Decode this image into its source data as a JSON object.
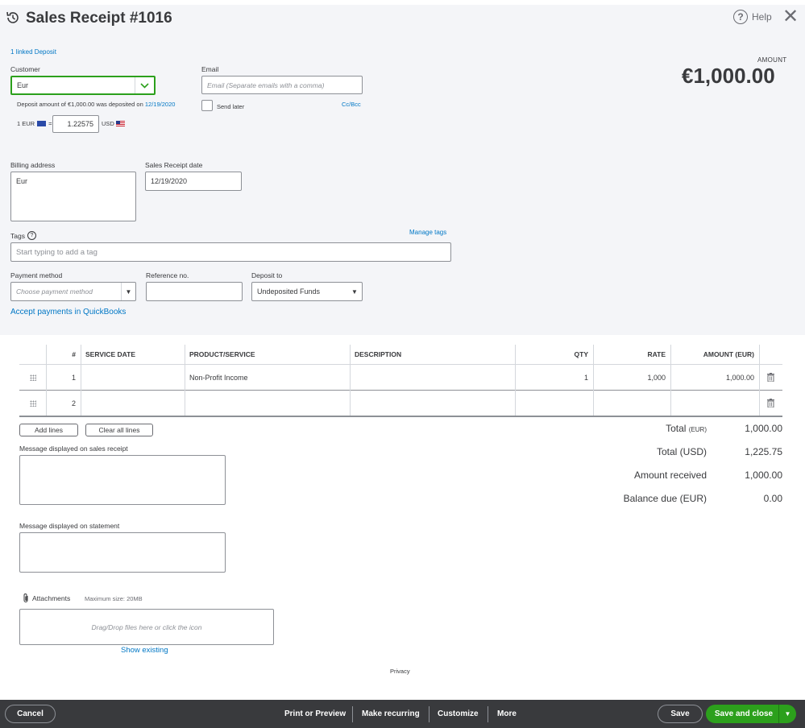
{
  "header": {
    "title": "Sales Receipt #1016",
    "help_label": "Help",
    "linked_deposit": "1 linked Deposit",
    "amount_label": "AMOUNT",
    "amount_value": "€1,000.00"
  },
  "customer": {
    "label": "Customer",
    "value": "Eur",
    "deposit_note": "Deposit amount of €1,000.00 was deposited on",
    "deposit_date": "12/19/2020"
  },
  "exchange": {
    "from": "1 EUR",
    "equals": "=",
    "rate": "1.22575",
    "to": "USD"
  },
  "email": {
    "label": "Email",
    "placeholder": "Email (Separate emails with a comma)",
    "send_later": "Send later",
    "cc_bcc": "Cc/Bcc"
  },
  "billing": {
    "label": "Billing address",
    "value": "Eur"
  },
  "receipt_date": {
    "label": "Sales Receipt date",
    "value": "12/19/2020"
  },
  "tags": {
    "label": "Tags",
    "manage": "Manage tags",
    "placeholder": "Start typing to add a tag"
  },
  "payment": {
    "method_label": "Payment method",
    "method_placeholder": "Choose payment method",
    "reference_label": "Reference no.",
    "reference_value": "",
    "deposit_label": "Deposit to",
    "deposit_value": "Undeposited Funds",
    "accept_link": "Accept payments in QuickBooks"
  },
  "table": {
    "headers": {
      "num": "#",
      "service_date": "SERVICE DATE",
      "product": "PRODUCT/SERVICE",
      "description": "DESCRIPTION",
      "qty": "QTY",
      "rate": "RATE",
      "amount": "AMOUNT (EUR)"
    },
    "rows": [
      {
        "num": "1",
        "service_date": "",
        "product": "Non-Profit Income",
        "description": "",
        "qty": "1",
        "rate": "1,000",
        "amount": "1,000.00"
      },
      {
        "num": "2",
        "service_date": "",
        "product": "",
        "description": "",
        "qty": "",
        "rate": "",
        "amount": ""
      }
    ],
    "add_lines": "Add lines",
    "clear_lines": "Clear all lines"
  },
  "messages": {
    "receipt_label": "Message displayed on sales receipt",
    "statement_label": "Message displayed on statement"
  },
  "attachments": {
    "label": "Attachments",
    "max_size": "Maximum size: 20MB",
    "drop_text": "Drag/Drop files here or click the icon",
    "show_existing": "Show existing"
  },
  "totals": {
    "total_label": "Total",
    "total_currency": "(EUR)",
    "total_value": "1,000.00",
    "total_usd_label": "Total (USD)",
    "total_usd_value": "1,225.75",
    "received_label": "Amount received",
    "received_value": "1,000.00",
    "balance_label": "Balance due (EUR)",
    "balance_value": "0.00"
  },
  "privacy": "Privacy",
  "footer": {
    "cancel": "Cancel",
    "print": "Print or Preview",
    "recurring": "Make recurring",
    "customize": "Customize",
    "more": "More",
    "save": "Save",
    "save_close": "Save and close"
  },
  "colors": {
    "link": "#0077c5",
    "primary_green": "#2ca01c",
    "footer_bg": "#393a3d",
    "panel_bg": "#f4f5f8"
  }
}
